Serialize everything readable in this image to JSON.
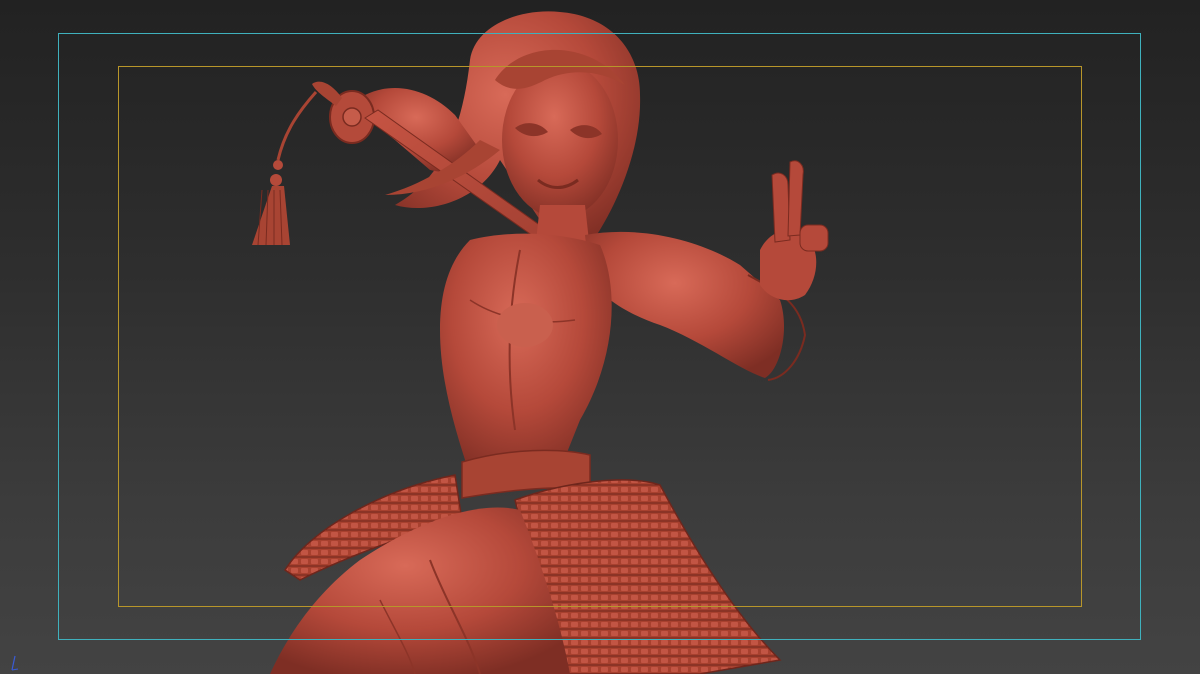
{
  "viewport": {
    "background_top": "#222222",
    "background_bottom": "#434343"
  },
  "safe_frames": {
    "action_safe_color": "#3fb1bd",
    "title_safe_color": "#b8962a"
  },
  "model": {
    "material_color": "#b5493a",
    "icon": "sculpt-figure-icon"
  },
  "axis_gizmo": {
    "icon": "axis-gizmo-icon",
    "color": "#3a5bd6"
  }
}
